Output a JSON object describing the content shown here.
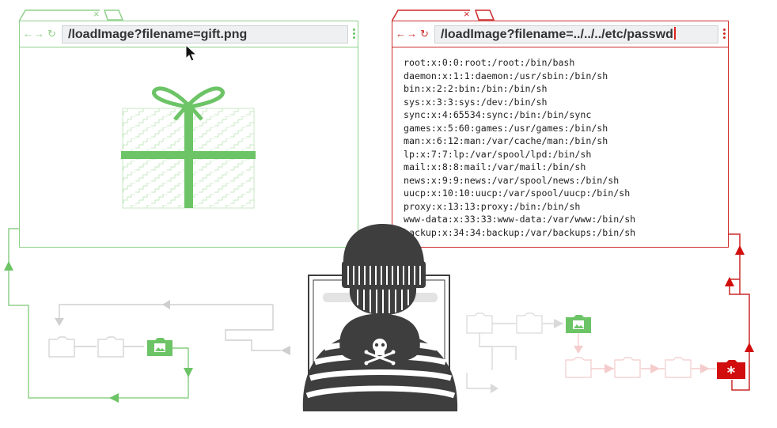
{
  "left_browser": {
    "url": "/loadImage?filename=gift.png",
    "tab_close_glyph": "×",
    "nav": {
      "back": "←",
      "forward": "→",
      "reload": "↻"
    },
    "content_icon": "gift-box-icon",
    "accent_color": "#6cc466"
  },
  "right_browser": {
    "url": "/loadImage?filename=../../../etc/passwd",
    "tab_close_glyph": "×",
    "nav": {
      "back": "←",
      "forward": "→",
      "reload": "↻"
    },
    "accent_color": "#cc2a2a",
    "file_lines": [
      "root:x:0:0:root:/root:/bin/bash",
      "daemon:x:1:1:daemon:/usr/sbin:/bin/sh",
      "bin:x:2:2:bin:/bin:/bin/sh",
      "sys:x:3:3:sys:/dev:/bin/sh",
      "sync:x:4:65534:sync:/bin:/bin/sync",
      "games:x:5:60:games:/usr/games:/bin/sh",
      "man:x:6:12:man:/var/cache/man:/bin/sh",
      "lp:x:7:7:lp:/var/spool/lpd:/bin/sh",
      "mail:x:8:8:mail:/var/mail:/bin/sh",
      "news:x:9:9:news:/var/spool/news:/bin/sh",
      "uucp:x:10:10:uucp:/var/spool/uucp:/bin/sh",
      "proxy:x:13:13:proxy:/bin:/bin/sh",
      "www-data:x:33:33:www-data:/var/www:/bin/sh",
      "backup:x:34:34:backup:/var/backups:/bin/sh"
    ]
  },
  "diagram": {
    "icons": [
      "folder-icon",
      "image-folder-icon",
      "sensitive-file-icon",
      "hacker-icon",
      "skull-icon",
      "mouse-pointer-icon"
    ],
    "colors": {
      "green": "#6cc466",
      "red": "#d10d0d",
      "gray": "#cfcfcf",
      "pink": "#f4cccc",
      "dark": "#3e3e3e"
    }
  }
}
